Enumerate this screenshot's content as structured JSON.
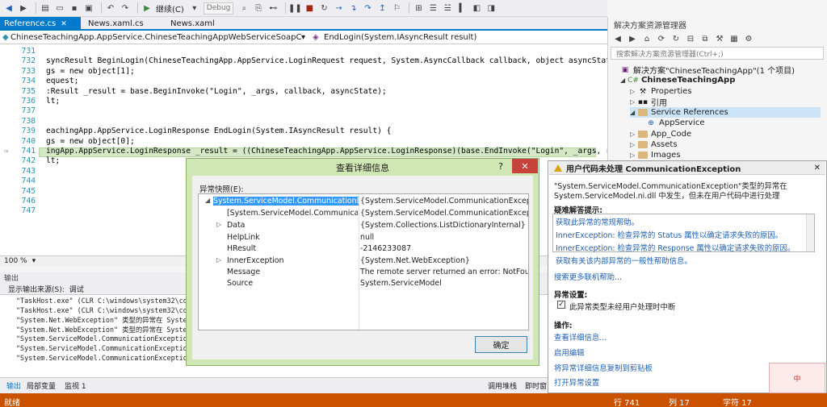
{
  "toolbar": {
    "continue_label": "继续(C)",
    "config": "Debug"
  },
  "tabs": [
    {
      "label": "Reference.cs"
    },
    {
      "label": "News.xaml.cs"
    },
    {
      "label": "News.xaml"
    }
  ],
  "navbar": {
    "class_path": "ChineseTeachingApp.AppService.ChineseTeachingAppWebServiceSoapClient.Chi",
    "member": "EndLogin(System.IAsyncResult result)"
  },
  "editor": {
    "lines": [
      {
        "num": "731",
        "text": ""
      },
      {
        "num": "732",
        "text": "syncResult BeginLogin(ChineseTeachingApp.AppService.LoginRequest request, System.AsyncCallback callback, object asyncState) {"
      },
      {
        "num": "733",
        "text": "gs = new object[1];"
      },
      {
        "num": "734",
        "text": "equest;"
      },
      {
        "num": "735",
        "text": ":Result _result = base.BeginInvoke(\"Login\", _args, callback, asyncState);"
      },
      {
        "num": "736",
        "text": "lt;"
      },
      {
        "num": "737",
        "text": ""
      },
      {
        "num": "738",
        "text": ""
      },
      {
        "num": "739",
        "text": "eachingApp.AppService.LoginResponse EndLogin(System.IAsyncResult result) {"
      },
      {
        "num": "740",
        "text": "gs = new object[0];"
      },
      {
        "num": "741",
        "text": "ingApp.AppService.LoginResponse _result = ((ChineseTeachingApp.AppService.LoginResponse)(base.EndInvoke(\"Login\", _args, result)));"
      },
      {
        "num": "742",
        "text": "lt;"
      },
      {
        "num": "743",
        "text": ""
      },
      {
        "num": "744",
        "text": ""
      },
      {
        "num": "745",
        "text": ""
      },
      {
        "num": "746",
        "text": ""
      },
      {
        "num": "747",
        "text": ""
      }
    ],
    "zoom": "100 %"
  },
  "output": {
    "header": "输出",
    "source_label": "显示输出来源(S):",
    "source_value": "调试",
    "lines": [
      "\"TaskHost.exe\" (CLR C:\\windows\\system32\\coreclr",
      "\"TaskHost.exe\" (CLR C:\\windows\\system32\\coreclr",
      "\"System.Net.WebException\" 类型的异常在 System.W",
      "\"System.Net.WebException\" 类型的异常在 System.W",
      "\"System.ServiceModel.CommunicationException\" 类",
      "\"System.ServiceModel.CommunicationException\" 类",
      "\"System.ServiceModel.CommunicationException\" 类"
    ]
  },
  "bottom_tabs": {
    "left": [
      "输出",
      "局部变量",
      "监视 1"
    ],
    "right": [
      "调用堆栈",
      "即时窗"
    ]
  },
  "status": {
    "ready": "就绪",
    "line": "行 741",
    "col": "列 17",
    "ch": "字符 17"
  },
  "solution_explorer": {
    "title": "解决方案资源管理器",
    "search_placeholder": "搜索解决方案资源管理器(Ctrl+;)",
    "items": [
      {
        "label": "解决方案\"ChineseTeachingApp\"(1 个项目)"
      },
      {
        "label": "ChineseTeachingApp"
      },
      {
        "label": "Properties"
      },
      {
        "label": "引用"
      },
      {
        "label": "Service References"
      },
      {
        "label": "AppService"
      },
      {
        "label": "App_Code"
      },
      {
        "label": "Assets"
      },
      {
        "label": "Images"
      }
    ]
  },
  "exception": {
    "title": "用户代码未处理 CommunicationException",
    "message_1": "\"System.ServiceModel.CommunicationException\"类型的异常在",
    "message_2": "System.ServiceModel.ni.dll 中发生，但未在用户代码中进行处理",
    "tips_title": "疑难解答提示:",
    "tips": [
      "获取此异常的常规帮助。",
      "InnerException: 检查异常的 Status 属性以确定请求失败的原因。",
      "InnerException: 检查异常的 Response 属性以确定请求失败的原因。",
      "获取有关该内部异常的一般性帮助信息。"
    ],
    "search_online": "搜索更多联机帮助...",
    "settings_title": "异常设置:",
    "break_checkbox": "此异常类型未经用户处理时中断",
    "actions_title": "操作:",
    "actions": [
      "查看详细信息...",
      "启用编辑",
      "将异常详细信息复制到剪贴板",
      "打开异常设置"
    ]
  },
  "dialog": {
    "title": "查看详细信息",
    "help": "?",
    "snapshot_label": "异常快照(E):",
    "rows": [
      {
        "name": "System.ServiceModel.CommunicationExc",
        "value": "{System.ServiceModel.CommunicationException"
      },
      {
        "name": "[System.ServiceModel.Communication",
        "value": "{System.ServiceModel.CommunicationException"
      },
      {
        "name": "Data",
        "value": "{System.Collections.ListDictionaryInternal}"
      },
      {
        "name": "HelpLink",
        "value": "null"
      },
      {
        "name": "HResult",
        "value": "-2146233087"
      },
      {
        "name": "InnerException",
        "value": "{System.Net.WebException}"
      },
      {
        "name": "Message",
        "value": "The remote server returned an error: NotFound"
      },
      {
        "name": "Source",
        "value": "System.ServiceModel"
      }
    ],
    "ok_label": "确定"
  },
  "mascot": {
    "label": "中"
  }
}
